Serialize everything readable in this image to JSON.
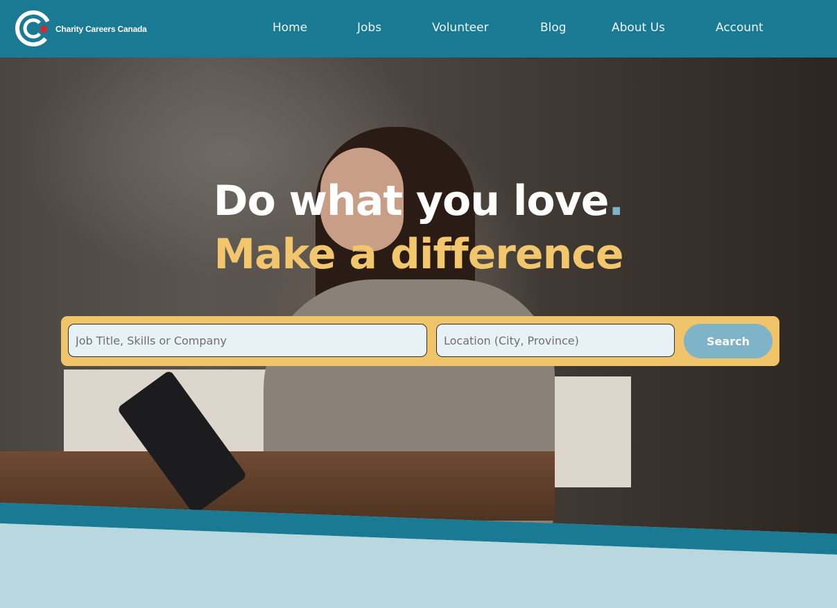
{
  "brand": {
    "name": "Charity Careers Canada"
  },
  "nav": {
    "items": [
      "Home",
      "Jobs",
      "Volunteer",
      "Blog",
      "About Us",
      "Account"
    ]
  },
  "hero": {
    "headline": "Do what you love",
    "headline_dot": ".",
    "subheadline": "Make a difference"
  },
  "search": {
    "job_placeholder": "Job Title, Skills or Company",
    "location_placeholder": "Location (City, Province)",
    "button_label": "Search"
  },
  "colors": {
    "header": "#1a7a93",
    "accent_yellow": "#f2c66d",
    "search_button": "#7fb3c7",
    "page_background": "#b9d7df"
  }
}
